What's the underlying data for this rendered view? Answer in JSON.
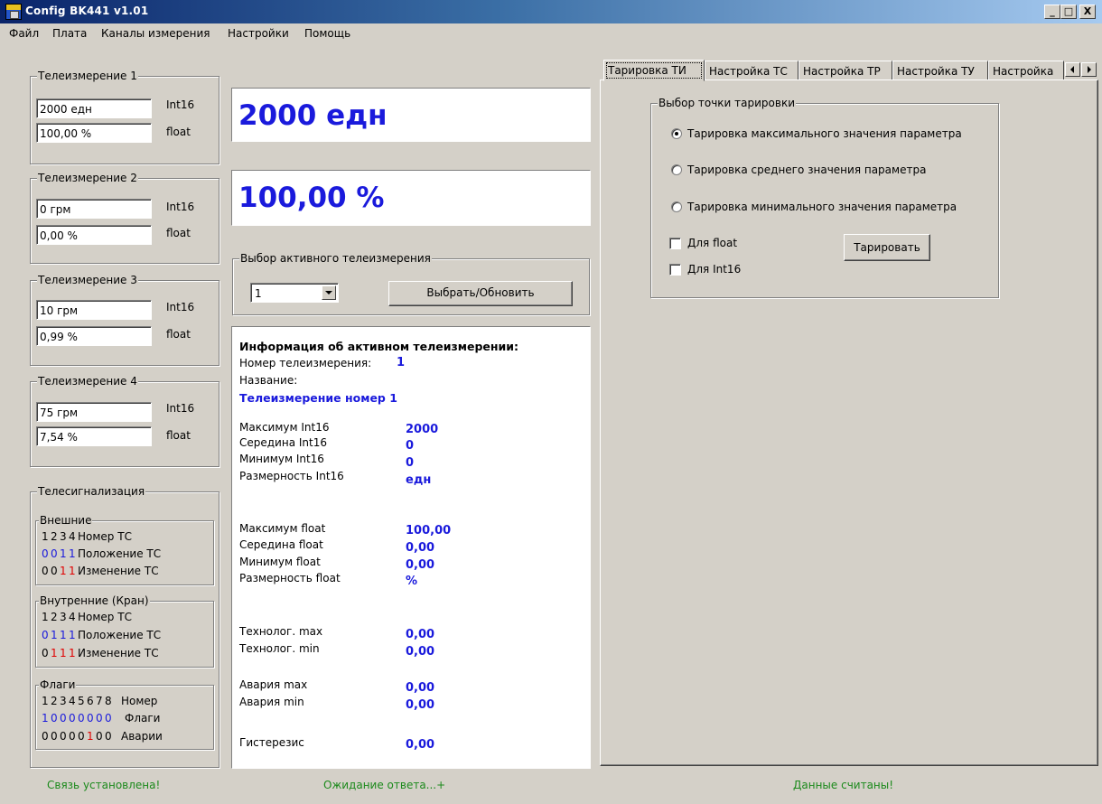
{
  "window": {
    "title": "Config BK441 v1.01",
    "min_label": "_",
    "max_label": "□",
    "close_label": "X"
  },
  "menu": [
    "Файл",
    "Плата",
    "Каналы измерения",
    "Настройки",
    "Помощь"
  ],
  "measurements": [
    {
      "title": "Телеизмерение 1",
      "int_value": "2000 едн",
      "float_value": "100,00 %",
      "int_label": "Int16",
      "float_label": "float"
    },
    {
      "title": "Телеизмерение 2",
      "int_value": "0 грм",
      "float_value": "0,00 %",
      "int_label": "Int16",
      "float_label": "float"
    },
    {
      "title": "Телеизмерение 3",
      "int_value": "10 грм",
      "float_value": "0,99 %",
      "int_label": "Int16",
      "float_label": "float"
    },
    {
      "title": "Телеизмерение 4",
      "int_value": "75 грм",
      "float_value": "7,54 %",
      "int_label": "Int16",
      "float_label": "float"
    }
  ],
  "telesignal": {
    "title": "Телесигнализация",
    "external": {
      "title": "Внешние",
      "header": [
        "1",
        "2",
        "3",
        "4"
      ],
      "header_label": "Номер ТС",
      "position": [
        "0",
        "0",
        "1",
        "1"
      ],
      "position_label": "Положение ТС",
      "change": [
        "0",
        "0",
        "1",
        "1"
      ],
      "change_label": "Изменение ТС"
    },
    "internal": {
      "title": "Внутренние (Кран)",
      "header": [
        "1",
        "2",
        "3",
        "4"
      ],
      "header_label": "Номер ТС",
      "position": [
        "0",
        "1",
        "1",
        "1"
      ],
      "position_label": "Положение ТС",
      "change": [
        "0",
        "1",
        "1",
        "1"
      ],
      "change_label": "Изменение ТС"
    },
    "flags": {
      "title": "Флаги",
      "header": [
        "1",
        "2",
        "3",
        "4",
        "5",
        "6",
        "7",
        "8"
      ],
      "header_label": "Номер",
      "flags": [
        "1",
        "0",
        "0",
        "0",
        "0",
        "0",
        "0",
        "0"
      ],
      "flags_label": "Флаги",
      "alarms": [
        "0",
        "0",
        "0",
        "0",
        "0",
        "1",
        "0",
        "0"
      ],
      "alarms_label": "Аварии"
    }
  },
  "display": {
    "int_big": "2000 едн",
    "float_big": "100,00 %"
  },
  "active_select": {
    "title": "Выбор активного телеизмерения",
    "combo_value": "1",
    "button_label": "Выбрать/Обновить"
  },
  "info": {
    "heading": "Информация об активном телеизмерении:",
    "number_label": "Номер телеизмерения:",
    "number_value": "1",
    "name_label": "Название:",
    "name_value": "Телеизмерение номер 1",
    "rows": [
      {
        "label": "Максимум Int16",
        "value": "2000"
      },
      {
        "label": "Середина Int16",
        "value": "0"
      },
      {
        "label": "Минимум Int16",
        "value": "0"
      },
      {
        "label": "Размерность Int16",
        "value": "едн"
      },
      {
        "label": "Максимум float",
        "value": "100,00"
      },
      {
        "label": "Середина float",
        "value": "0,00"
      },
      {
        "label": "Минимум float",
        "value": "0,00"
      },
      {
        "label": "Размерность float",
        "value": "%"
      },
      {
        "label": "Технолог. max",
        "value": "0,00"
      },
      {
        "label": "Технолог. min",
        "value": "0,00"
      },
      {
        "label": "Авария max",
        "value": "0,00"
      },
      {
        "label": "Авария min",
        "value": "0,00"
      },
      {
        "label": "Гистерезис",
        "value": "0,00"
      }
    ]
  },
  "tabs": [
    "Тарировка ТИ",
    "Настройка ТС",
    "Настройка ТР",
    "Настройка ТУ",
    "Настройка"
  ],
  "calibration": {
    "group_title": "Выбор точки тарировки",
    "radios": [
      {
        "label": "Тарировка максимального значения параметра",
        "checked": true
      },
      {
        "label": "Тарировка среднего значения параметра",
        "checked": false
      },
      {
        "label": "Тарировка минимального значения параметра",
        "checked": false
      }
    ],
    "check_float": "Для float",
    "check_int": "Для Int16",
    "button_label": "Тарировать"
  },
  "status": {
    "left": "Связь установлена!",
    "center": "Ожидание ответа...+",
    "right": "Данные считаны!"
  },
  "colors": {
    "value_blue": "#1a1adc",
    "alarm_red": "#e00000",
    "status_green": "#1c8a1c"
  }
}
